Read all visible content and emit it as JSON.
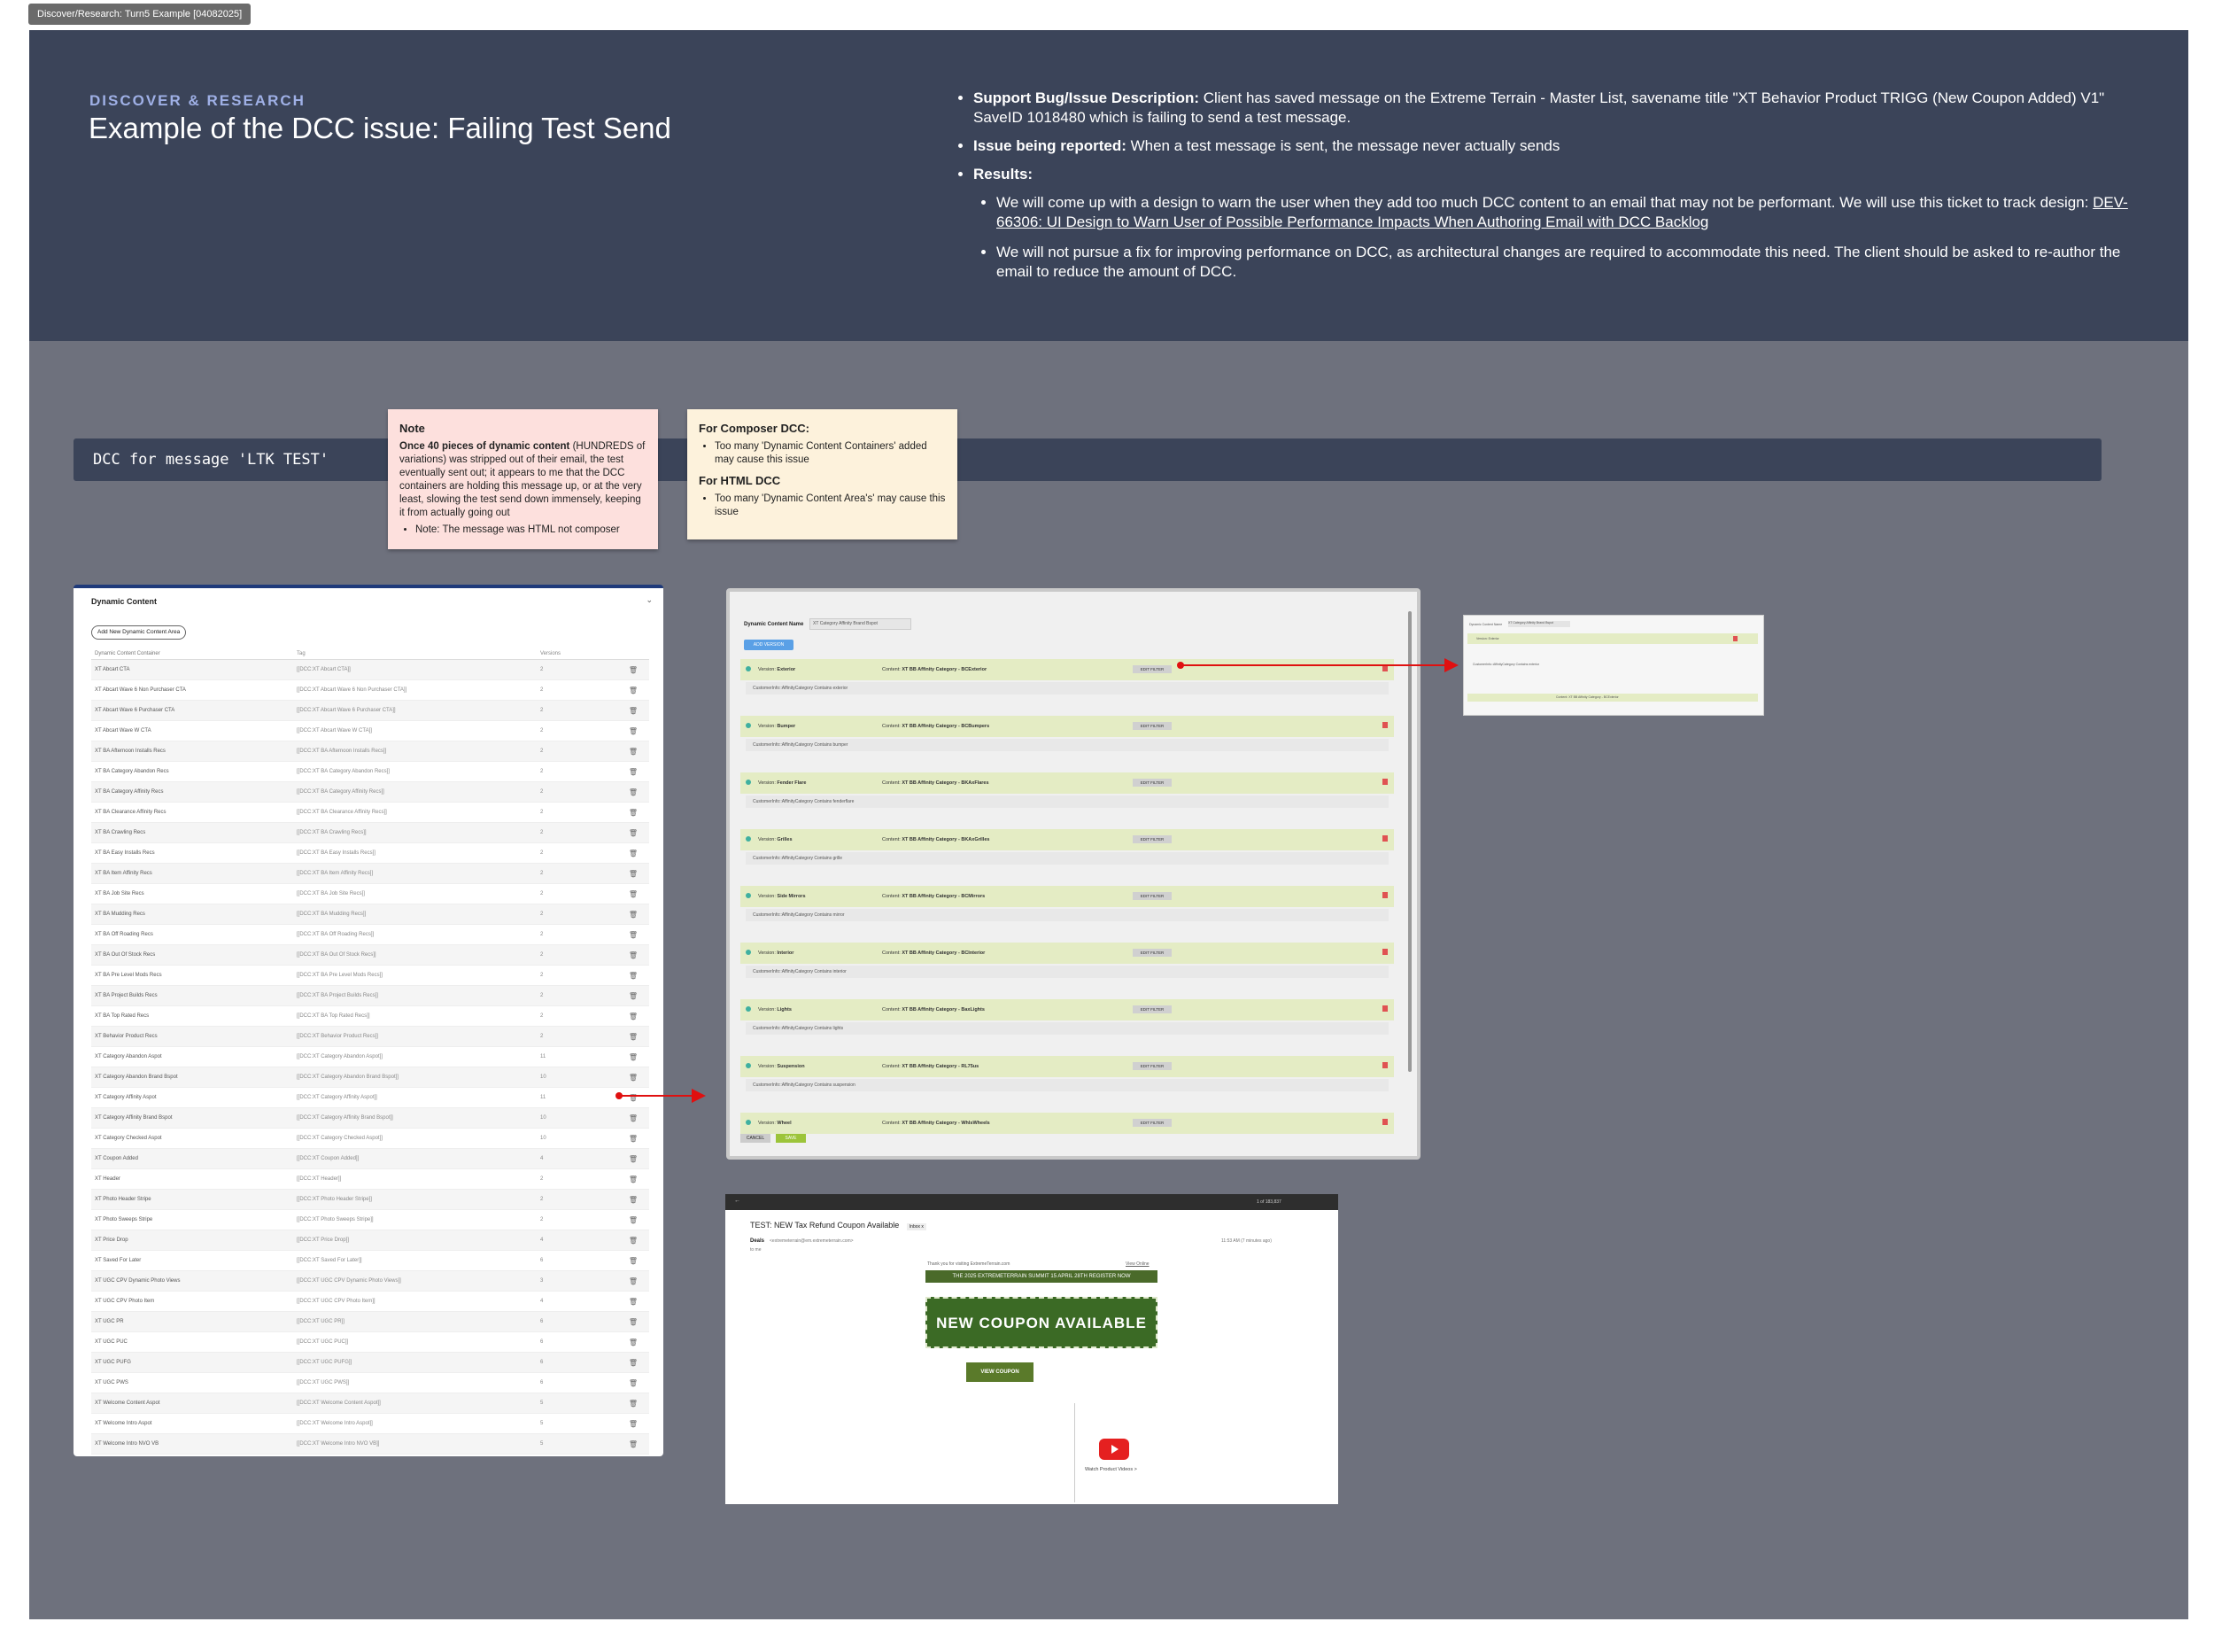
{
  "frame_tag": "Discover/Research: Turn5 Example [04082025]",
  "header": {
    "eyebrow": "DISCOVER & RESEARCH",
    "title": "Example of the DCC issue: Failing Test Send",
    "bullets": {
      "support_label": "Support Bug/Issue Description:",
      "support_text": " Client has saved message on the Extreme Terrain - Master List, savename title \"XT Behavior Product TRIGG (New Coupon Added) V1\" SaveID 1018480 which is failing to send a test message.",
      "issue_label": "Issue being reported:",
      "issue_text": " When a test message is sent, the message never actually sends",
      "results_label": "Results:",
      "result1_text": "We will come up with a design to warn the user when they add too much DCC content to an email that may not be performant. We will use this ticket to track design: ",
      "result1_link": "DEV-66306: UI Design to Warn User of Possible Performance Impacts When Authoring Email with DCC Backlog",
      "result2_text": "We will not pursue a fix for improving performance on DCC, as architectural changes are required to accommodate this need. The client should be asked to re-author the email to reduce the amount of DCC."
    }
  },
  "banner": {
    "text": "DCC for message 'LTK TEST'"
  },
  "note": {
    "title": "Note",
    "bold": "Once 40 pieces of dynamic content",
    "body": " (HUNDREDS of variations) was stripped out of their email, the test eventually sent out; it appears to me that the DCC containers are holding this message up, or at the very least, slowing the test send down immensely, keeping it from actually going out",
    "sub": "Note: The message was HTML not composer"
  },
  "composer": {
    "title1": "For Composer DCC:",
    "item1": "Too many 'Dynamic Content Containers' added may cause this issue",
    "title2": "For HTML DCC",
    "item2": "Too many 'Dynamic Content Area's' may cause this issue"
  },
  "dc_panel": {
    "title": "Dynamic Content",
    "add_button": "Add New Dynamic Content Area",
    "columns": [
      "Dynamic Content Container",
      "Tag",
      "Versions"
    ],
    "rows": [
      [
        "XT Abcart CTA",
        "[[DCC:XT Abcart CTA]]",
        "2"
      ],
      [
        "XT Abcart Wave 6 Non Purchaser CTA",
        "[[DCC:XT Abcart Wave 6 Non Purchaser CTA]]",
        "2"
      ],
      [
        "XT Abcart Wave 6 Purchaser CTA",
        "[[DCC:XT Abcart Wave 6 Purchaser CTA]]",
        "2"
      ],
      [
        "XT Abcart Wave W CTA",
        "[[DCC:XT Abcart Wave W CTA]]",
        "2"
      ],
      [
        "XT BA Afternoon Installs Recs",
        "[[DCC:XT BA Afternoon Installs Recs]]",
        "2"
      ],
      [
        "XT BA Category Abandon Recs",
        "[[DCC:XT BA Category Abandon Recs]]",
        "2"
      ],
      [
        "XT BA Category Affinity Recs",
        "[[DCC:XT BA Category Affinity Recs]]",
        "2"
      ],
      [
        "XT BA Clearance Affinity Recs",
        "[[DCC:XT BA Clearance Affinity Recs]]",
        "2"
      ],
      [
        "XT BA Crawling Recs",
        "[[DCC:XT BA Crawling Recs]]",
        "2"
      ],
      [
        "XT BA Easy Installs Recs",
        "[[DCC:XT BA Easy Installs Recs]]",
        "2"
      ],
      [
        "XT BA Item Affinity Recs",
        "[[DCC:XT BA Item Affinity Recs]]",
        "2"
      ],
      [
        "XT BA Job Site Recs",
        "[[DCC:XT BA Job Site Recs]]",
        "2"
      ],
      [
        "XT BA Mudding Recs",
        "[[DCC:XT BA Mudding Recs]]",
        "2"
      ],
      [
        "XT BA Off Roading Recs",
        "[[DCC:XT BA Off Roading Recs]]",
        "2"
      ],
      [
        "XT BA Out Of Stock Recs",
        "[[DCC:XT BA Out Of Stock Recs]]",
        "2"
      ],
      [
        "XT BA Pre Level Mods Recs",
        "[[DCC:XT BA Pre Level Mods Recs]]",
        "2"
      ],
      [
        "XT BA Project Builds Recs",
        "[[DCC:XT BA Project Builds Recs]]",
        "2"
      ],
      [
        "XT BA Top Rated Recs",
        "[[DCC:XT BA Top Rated Recs]]",
        "2"
      ],
      [
        "XT Behavior Product Recs",
        "[[DCC:XT Behavior Product Recs]]",
        "2"
      ],
      [
        "XT Category Abandon Aspot",
        "[[DCC:XT Category Abandon Aspot]]",
        "11"
      ],
      [
        "XT Category Abandon Brand Bspot",
        "[[DCC:XT Category Abandon Brand Bspot]]",
        "10"
      ],
      [
        "XT Category Affinity Aspot",
        "[[DCC:XT Category Affinity Aspot]]",
        "11"
      ],
      [
        "XT Category Affinity Brand Bspot",
        "[[DCC:XT Category Affinity Brand Bspot]]",
        "10"
      ],
      [
        "XT Category Checked Aspot",
        "[[DCC:XT Category Checked Aspot]]",
        "10"
      ],
      [
        "XT Coupon Added",
        "[[DCC:XT Coupon Added]]",
        "4"
      ],
      [
        "XT Header",
        "[[DCC:XT Header]]",
        "2"
      ],
      [
        "XT Photo Header Stripe",
        "[[DCC:XT Photo Header Stripe]]",
        "2"
      ],
      [
        "XT Photo Sweeps Stripe",
        "[[DCC:XT Photo Sweeps Stripe]]",
        "2"
      ],
      [
        "XT Price Drop",
        "[[DCC:XT Price Drop]]",
        "4"
      ],
      [
        "XT Saved For Later",
        "[[DCC:XT Saved For Later]]",
        "6"
      ],
      [
        "XT UGC CPV Dynamic Photo Views",
        "[[DCC:XT UGC CPV Dynamic Photo Views]]",
        "3"
      ],
      [
        "XT UGC CPV Photo Item",
        "[[DCC:XT UGC CPV Photo Item]]",
        "4"
      ],
      [
        "XT UGC PR",
        "[[DCC:XT UGC PR]]",
        "6"
      ],
      [
        "XT UGC PUC",
        "[[DCC:XT UGC PUC]]",
        "6"
      ],
      [
        "XT UGC PUFG",
        "[[DCC:XT UGC PUFG]]",
        "6"
      ],
      [
        "XT UGC PWS",
        "[[DCC:XT UGC PWS]]",
        "6"
      ],
      [
        "XT Welcome Content Aspot",
        "[[DCC:XT Welcome Content Aspot]]",
        "5"
      ],
      [
        "XT Welcome Intro Aspot",
        "[[DCC:XT Welcome Intro Aspot]]",
        "5"
      ],
      [
        "XT Welcome Intro NVO VB",
        "[[DCC:XT Welcome Intro NVO VB]]",
        "5"
      ],
      [
        "XT Welcome Offer Aspot",
        "[[DCC:XT Welcome Offer Aspot]]",
        "5"
      ]
    ]
  },
  "modal": {
    "name_label": "Dynamic Content Name",
    "name_value": "XT Category Affinity Brand Bspot",
    "add_version": "ADD VERSION",
    "edit_filter": "EDIT FILTER",
    "cancel": "CANCEL",
    "save": "SAVE",
    "versions": [
      {
        "version": "Exterior",
        "content": "XT BB Affinity Category - BCExterior",
        "condition": "CustomerInfo::AffinityCategory Contains exterior"
      },
      {
        "version": "Bumper",
        "content": "XT BB Affinity Category - BCBumpers",
        "condition": "CustomerInfo::AffinityCategory Contains bumper"
      },
      {
        "version": "Fender Flare",
        "content": "XT BB Affinity Category - BKAxFlares",
        "condition": "CustomerInfo::AffinityCategory Contains fenderflare"
      },
      {
        "version": "Grilles",
        "content": "XT BB Affinity Category - BKAxGrilles",
        "condition": "CustomerInfo::AffinityCategory Contains grille"
      },
      {
        "version": "Side Mirrors",
        "content": "XT BB Affinity Category - BCMirrors",
        "condition": "CustomerInfo::AffinityCategory Contains mirror"
      },
      {
        "version": "Interior",
        "content": "XT BB Affinity Category - BCInterior",
        "condition": "CustomerInfo::AffinityCategory Contains interior"
      },
      {
        "version": "Lights",
        "content": "XT BB Affinity Category - BaxLights",
        "condition": "CustomerInfo::AffinityCategory Contains lights"
      },
      {
        "version": "Suspension",
        "content": "XT BB Affinity Category - RL75us",
        "condition": "CustomerInfo::AffinityCategory Contains suspension"
      },
      {
        "version": "Wheel",
        "content": "XT BB Affinity Category - WhlsWheels",
        "condition": ""
      }
    ]
  },
  "thumbnail": {
    "name_label": "Dynamic Content Name",
    "name_value": "XT Category Affinity Brand Bspot",
    "version": "Version: Exterior",
    "condition": "CustomerInfo::AffinityCategory Contains exterior",
    "content": "Content: XT BB Affinity Category - BCExterior"
  },
  "email": {
    "count": "1 of 183,837",
    "subject": "TEST: NEW Tax Refund Coupon Available",
    "inbox_chip": "Inbox x",
    "from_name": "Deals",
    "from_addr": "<extremeterrain@em.extremeterrain.com>",
    "to": "to me",
    "time": "11:53 AM (7 minutes ago)",
    "thanks": "Thank you for visiting ExtremeTerrain.com",
    "view_online": "View Online",
    "promo": "THE 2025 EXTREMETERRAIN SUMMIT 15 APRIL 28TH REGISTER NOW",
    "coupon": "NEW COUPON AVAILABLE",
    "view_coupon": "VIEW COUPON",
    "videos": "Watch Product Videos >"
  },
  "colors": {
    "header_bg": "#3b4459",
    "canvas_bg": "#6e717d",
    "accent": "#9fb0e6",
    "arrow": "#e01010",
    "version_row": "#e4ecc4"
  }
}
